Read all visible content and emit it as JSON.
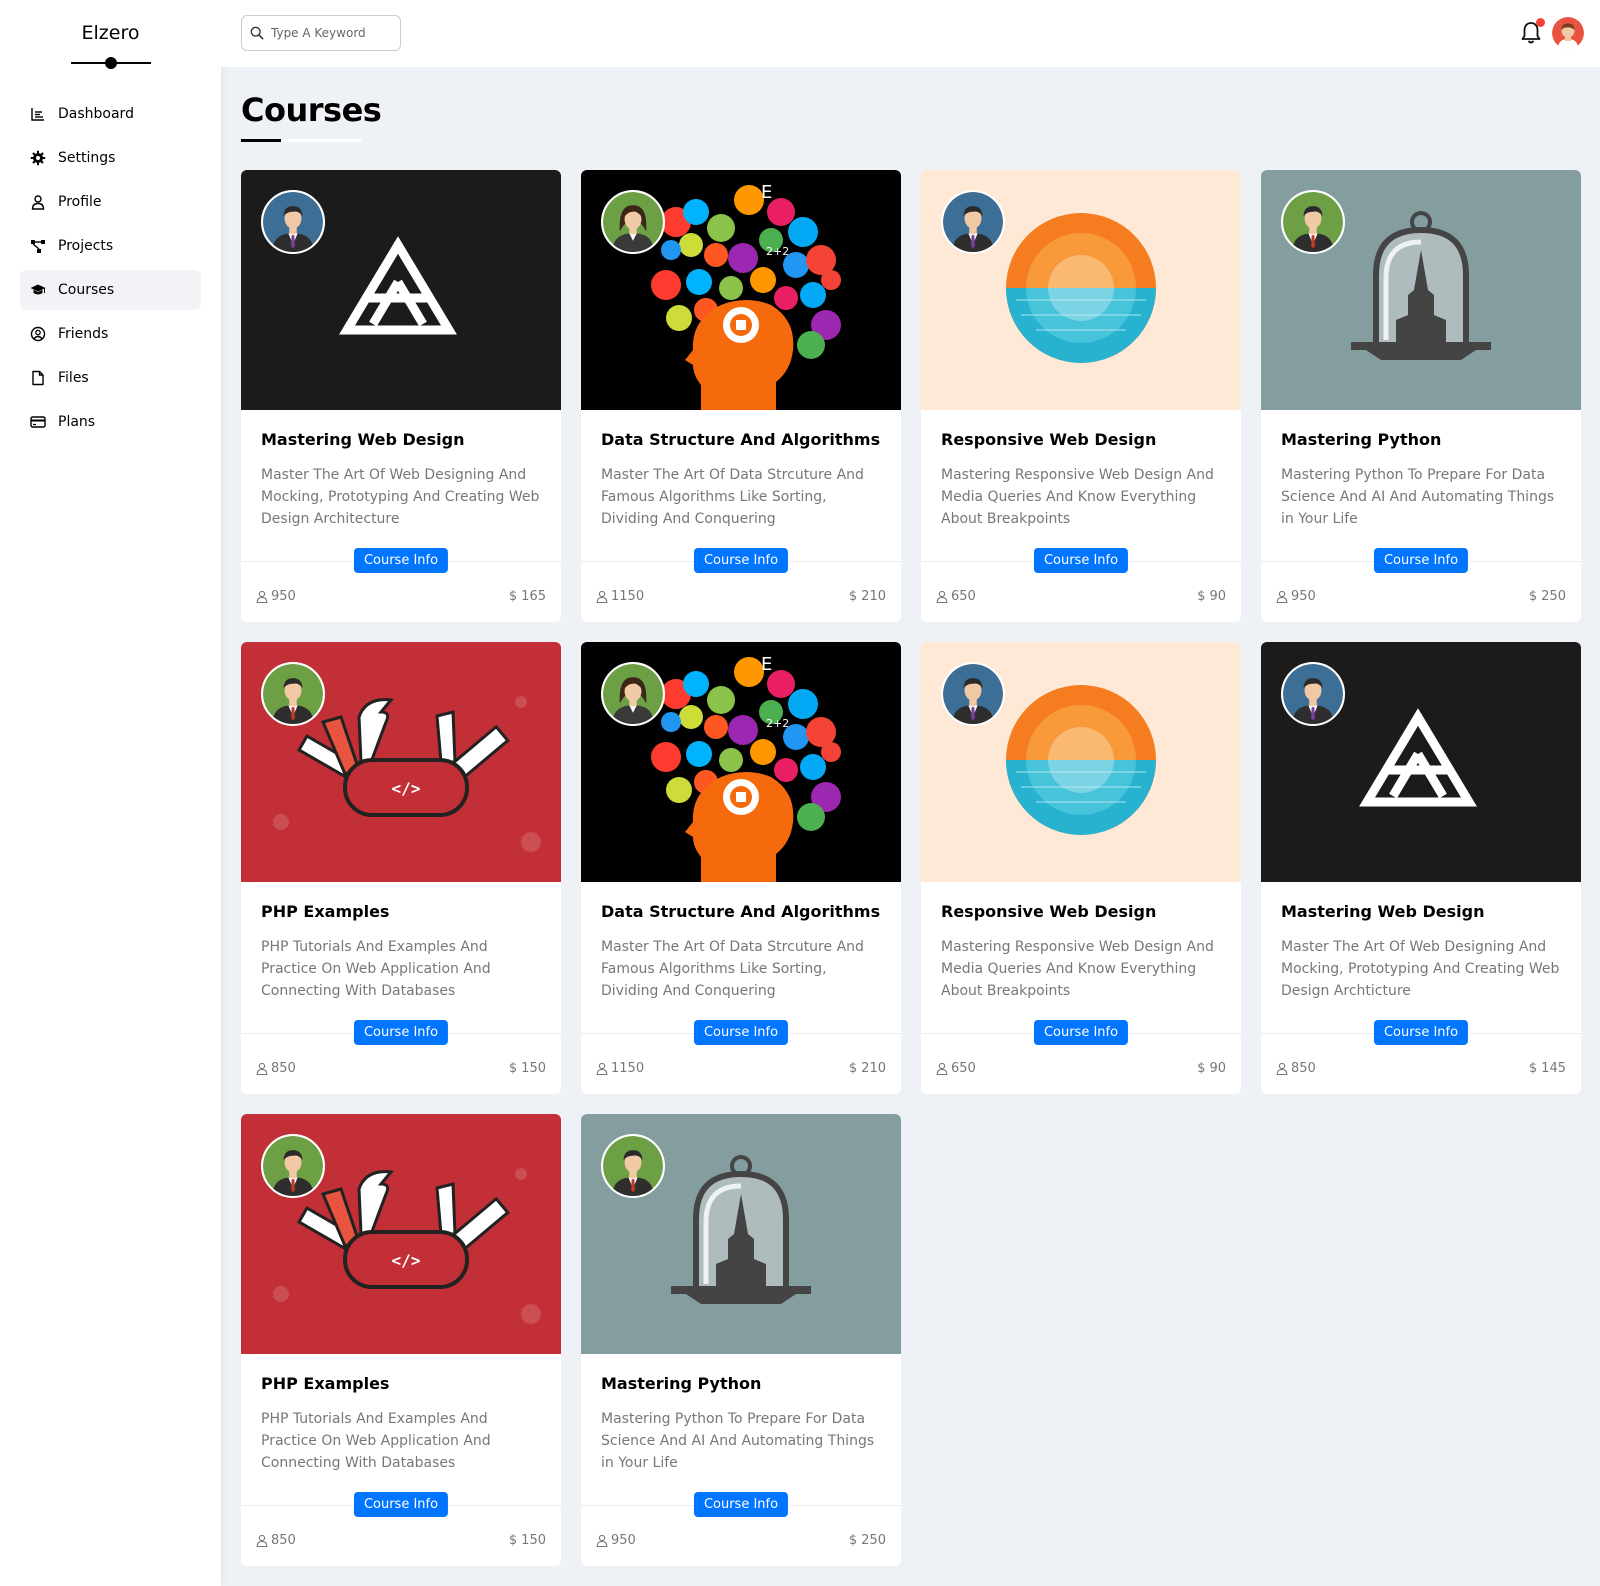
{
  "brand": {
    "title": "Elzero"
  },
  "sidebar": {
    "items": [
      {
        "label": "Dashboard",
        "icon": "chart-icon",
        "active": false
      },
      {
        "label": "Settings",
        "icon": "gear-icon",
        "active": false
      },
      {
        "label": "Profile",
        "icon": "user-icon",
        "active": false
      },
      {
        "label": "Projects",
        "icon": "diagram-icon",
        "active": false
      },
      {
        "label": "Courses",
        "icon": "graduation-cap-icon",
        "active": true
      },
      {
        "label": "Friends",
        "icon": "user-circle-icon",
        "active": false
      },
      {
        "label": "Files",
        "icon": "file-icon",
        "active": false
      },
      {
        "label": "Plans",
        "icon": "credit-card-icon",
        "active": false
      }
    ]
  },
  "header": {
    "search_placeholder": "Type A Keyword",
    "notification_icon": "bell-icon",
    "avatar_icon": "avatar"
  },
  "page": {
    "title": "Courses"
  },
  "colors": {
    "accent": "#0075ff",
    "notification": "#f44336"
  },
  "courses": [
    {
      "title": "Mastering Web Design",
      "desc": "Master The Art Of Web Designing And Mocking, Prototyping And Creating Web Design Architecture",
      "button": "Course Info",
      "students": "950",
      "price": "165",
      "currency": "$",
      "cover": "webdesign",
      "author": "blue"
    },
    {
      "title": "Data Structure And Algorithms",
      "desc": "Master The Art Of Data Strcuture And Famous Algorithms Like Sorting, Dividing And Conquering",
      "button": "Course Info",
      "students": "1150",
      "price": "210",
      "currency": "$",
      "cover": "data",
      "author": "green-woman"
    },
    {
      "title": "Responsive Web Design",
      "desc": "Mastering Responsive Web Design And Media Queries And Know Everything About Breakpoints",
      "button": "Course Info",
      "students": "650",
      "price": "90",
      "currency": "$",
      "cover": "responsive",
      "author": "blue"
    },
    {
      "title": "Mastering Python",
      "desc": "Mastering Python To Prepare For Data Science And AI And Automating Things in Your Life",
      "button": "Course Info",
      "students": "950",
      "price": "250",
      "currency": "$",
      "cover": "python",
      "author": "green"
    },
    {
      "title": "PHP Examples",
      "desc": "PHP Tutorials And Examples And Practice On Web Application And Connecting With Databases",
      "button": "Course Info",
      "students": "850",
      "price": "150",
      "currency": "$",
      "cover": "php",
      "author": "green"
    },
    {
      "title": "Data Structure And Algorithms",
      "desc": "Master The Art Of Data Strcuture And Famous Algorithms Like Sorting, Dividing And Conquering",
      "button": "Course Info",
      "students": "1150",
      "price": "210",
      "currency": "$",
      "cover": "data",
      "author": "green-woman"
    },
    {
      "title": "Responsive Web Design",
      "desc": "Mastering Responsive Web Design And Media Queries And Know Everything About Breakpoints",
      "button": "Course Info",
      "students": "650",
      "price": "90",
      "currency": "$",
      "cover": "responsive",
      "author": "blue"
    },
    {
      "title": "Mastering Web Design",
      "desc": "Master The Art Of Web Designing And Mocking, Prototyping And Creating Web Design Archticture",
      "button": "Course Info",
      "students": "850",
      "price": "145",
      "currency": "$",
      "cover": "webdesign",
      "author": "blue"
    },
    {
      "title": "PHP Examples",
      "desc": "PHP Tutorials And Examples And Practice On Web Application And Connecting With Databases",
      "button": "Course Info",
      "students": "850",
      "price": "150",
      "currency": "$",
      "cover": "php",
      "author": "green"
    },
    {
      "title": "Mastering Python",
      "desc": "Mastering Python To Prepare For Data Science And AI And Automating Things in Your Life",
      "button": "Course Info",
      "students": "950",
      "price": "250",
      "currency": "$",
      "cover": "python",
      "author": "green"
    }
  ]
}
